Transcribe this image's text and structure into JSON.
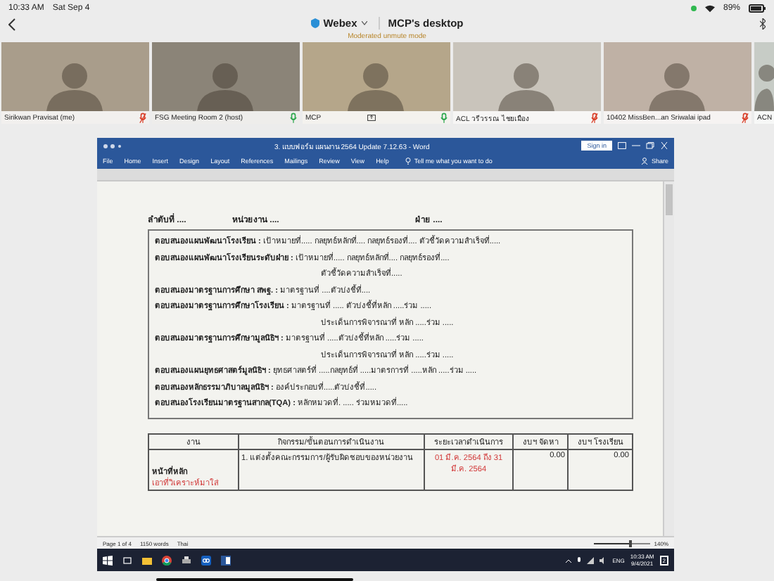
{
  "status_bar": {
    "time": "10:33 AM",
    "date": "Sat Sep 4",
    "battery": "89%"
  },
  "header": {
    "app_menu": "Webex",
    "title": "MCP's desktop",
    "subtitle": "Moderated unmute mode"
  },
  "participants": [
    {
      "name": "Sirikwan Pravisat (me)",
      "muted": true,
      "sharing": false
    },
    {
      "name": "FSG Meeting Room 2 (host)",
      "muted": false,
      "sharing": false
    },
    {
      "name": "MCP",
      "muted": false,
      "sharing": true
    },
    {
      "name": "ACL วรีวรรณ ไชยเมือง",
      "muted": true,
      "sharing": false
    },
    {
      "name": "10402 MissBen...an Sriwalai ipad",
      "muted": true,
      "sharing": false
    },
    {
      "name": "ACN"
    }
  ],
  "word": {
    "title": "3. แบบฟอร์ม แผนงาน 2564 Update 7.12.63 - Word",
    "sign_in": "Sign in",
    "ribbon_tabs": [
      "File",
      "Home",
      "Insert",
      "Design",
      "Layout",
      "References",
      "Mailings",
      "Review",
      "View",
      "Help"
    ],
    "tell_me": "Tell me what you want to do",
    "share": "Share",
    "document": {
      "header_fields": [
        "ลำดับที่ ....",
        "หน่วยงาน ....",
        "ฝ่าย ...."
      ],
      "lines": [
        {
          "kind": "main",
          "text": "**ตอบสนองแผนพัฒนาโรงเรียน :** เป้าหมายที่..... กลยุทธ์หลักที่.... กลยุทธ์รองที่.... ตัวชี้วัดความสำเร็จที่....."
        },
        {
          "kind": "main",
          "text": "**ตอบสนองแผนพัฒนาโรงเรียนระดับฝ่าย :** เป้าหมายที่..... กลยุทธ์หลักที่.... กลยุทธ์รองที่...."
        },
        {
          "kind": "continuation",
          "text": "ตัวชี้วัดความสำเร็จที่....."
        },
        {
          "kind": "main",
          "text": "**ตอบสนองมาตรฐานการศึกษา สพฐ. :** มาตรฐานที่ ....ตัวบ่งชี้ที่...."
        },
        {
          "kind": "main",
          "text": "**ตอบสนองมาตรฐานการศึกษาโรงเรียน :** มาตรฐานที่ ..... ตัวบ่งชี้ที่หลัก .....ร่วม ....."
        },
        {
          "kind": "continuation",
          "text": "ประเด็นการพิจารณาที่ หลัก .....ร่วม ....."
        },
        {
          "kind": "main",
          "text": "**ตอบสนองมาตรฐานการศึกษามูลนิธิฯ :** มาตรฐานที่ .....ตัวบ่งชี้ที่หลัก .....ร่วม ....."
        },
        {
          "kind": "continuation",
          "text": "ประเด็นการพิจารณาที่ หลัก .....ร่วม ....."
        },
        {
          "kind": "main",
          "text": "**ตอบสนองแผนยุทธศาสตร์มูลนิธิฯ :** ยุทธศาสตร์ที่ .....กลยุทธ์ที่ .....มาตรการที่ .....หลัก .....ร่วม ....."
        },
        {
          "kind": "main",
          "text": "**ตอบสนองหลักธรรมาภิบาลมูลนิธิฯ :** องค์ประกอบที่.....ตัวบ่งชี้ที่....."
        },
        {
          "kind": "main",
          "text": "**ตอบสนองโรงเรียนมาตรฐานสากล(TQA) :** หลักหมวดที่. ..... ร่วมหมวดที่....."
        }
      ],
      "table": {
        "columns": [
          "งาน",
          "กิจกรรม/ขั้นตอนการดำเนินงาน",
          "ระยะเวลาดำเนินการ",
          "งบฯ จัดหา",
          "งบฯ โรงเรียน"
        ],
        "rows": [
          {
            "task": "หน้าที่หลัก",
            "task_note": "เอาที่วิเคราะห์มาใส่",
            "activity": "1. แต่งตั้งคณะกรรมการ/ผู้รับผิดชอบของหน่วยงาน",
            "period": "01 มี.ค. 2564 ถึง 31 มี.ค. 2564",
            "budget_procured": "0.00",
            "budget_school": "0.00"
          }
        ]
      }
    },
    "status": {
      "page": "Page 1 of 4",
      "words": "1150 words",
      "language": "Thai",
      "zoom": "140%",
      "level": 0.65
    }
  },
  "taskbar": {
    "language": "ENG",
    "time": "10:33 AM",
    "date": "9/4/2021",
    "notifications": "2"
  }
}
